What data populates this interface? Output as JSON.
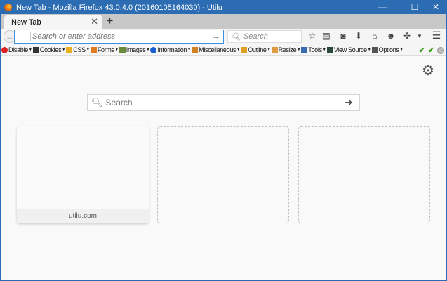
{
  "window": {
    "title": "New Tab - Mozilla Firefox 43.0.4.0 (20160105164030) - Utilu",
    "controls": {
      "minimize": "—",
      "maximize": "☐",
      "close": "✕"
    }
  },
  "tabs": [
    {
      "label": "New Tab",
      "active": true
    }
  ],
  "navbar": {
    "url_placeholder": "Search or enter address",
    "search_placeholder": "Search",
    "icons": [
      "star-icon",
      "reading-list-icon",
      "pocket-icon",
      "download-icon",
      "home-icon",
      "hello-icon",
      "extension-icon",
      "overflow-icon",
      "menu-icon"
    ]
  },
  "webdev_toolbar": {
    "items": [
      {
        "label": "Disable",
        "icon": "disable-icon",
        "color": "#d22"
      },
      {
        "label": "Cookies",
        "icon": "cookies-icon",
        "color": "#333"
      },
      {
        "label": "CSS",
        "icon": "css-icon",
        "color": "#e8b020"
      },
      {
        "label": "Forms",
        "icon": "forms-icon",
        "color": "#e07a20"
      },
      {
        "label": "Images",
        "icon": "images-icon",
        "color": "#6a8a3a"
      },
      {
        "label": "Information",
        "icon": "information-icon",
        "color": "#1a5fd0"
      },
      {
        "label": "Miscellaneous",
        "icon": "miscellaneous-icon",
        "color": "#d08020"
      },
      {
        "label": "Outline",
        "icon": "outline-icon",
        "color": "#e0a020"
      },
      {
        "label": "Resize",
        "icon": "resize-icon",
        "color": "#e09a40"
      },
      {
        "label": "Tools",
        "icon": "tools-icon",
        "color": "#3a6ab0"
      },
      {
        "label": "View Source",
        "icon": "view-source-icon",
        "color": "#2a4a3a"
      },
      {
        "label": "Options",
        "icon": "options-icon",
        "color": "#555"
      }
    ]
  },
  "newtab": {
    "search_placeholder": "Search",
    "tiles": [
      {
        "label": "utilu.com"
      },
      {
        "label": ""
      },
      {
        "label": ""
      }
    ]
  },
  "colors": {
    "titlebar": "#2b6cb3",
    "accent": "#3a8ee6"
  }
}
